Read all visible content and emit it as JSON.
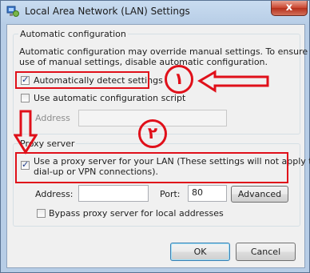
{
  "window": {
    "title": "Local Area Network (LAN) Settings",
    "close_glyph": "x",
    "icon": "network-settings-icon"
  },
  "auto_config": {
    "group_title": "Automatic configuration",
    "description_line1": "Automatic configuration may override manual settings.  To ensure the",
    "description_line2": "use of manual settings, disable automatic configuration.",
    "auto_detect_label": "Automatically detect settings",
    "auto_detect_checked": true,
    "use_script_label": "Use automatic configuration script",
    "use_script_checked": false,
    "address_label": "Address",
    "address_value": ""
  },
  "proxy": {
    "group_title": "Proxy server",
    "use_proxy_label_line1": "Use a proxy server for your LAN (These settings will not apply to",
    "use_proxy_label_line2": "dial-up or VPN connections).",
    "use_proxy_checked": true,
    "address_label": "Address:",
    "address_value": "",
    "port_label": "Port:",
    "port_value": "80",
    "advanced_label": "Advanced",
    "bypass_label": "Bypass proxy server for local addresses",
    "bypass_checked": false
  },
  "annotations": {
    "marker_1": "١",
    "marker_2": "٢",
    "color": "#e0101a"
  },
  "footer": {
    "ok_label": "OK",
    "cancel_label": "Cancel"
  }
}
